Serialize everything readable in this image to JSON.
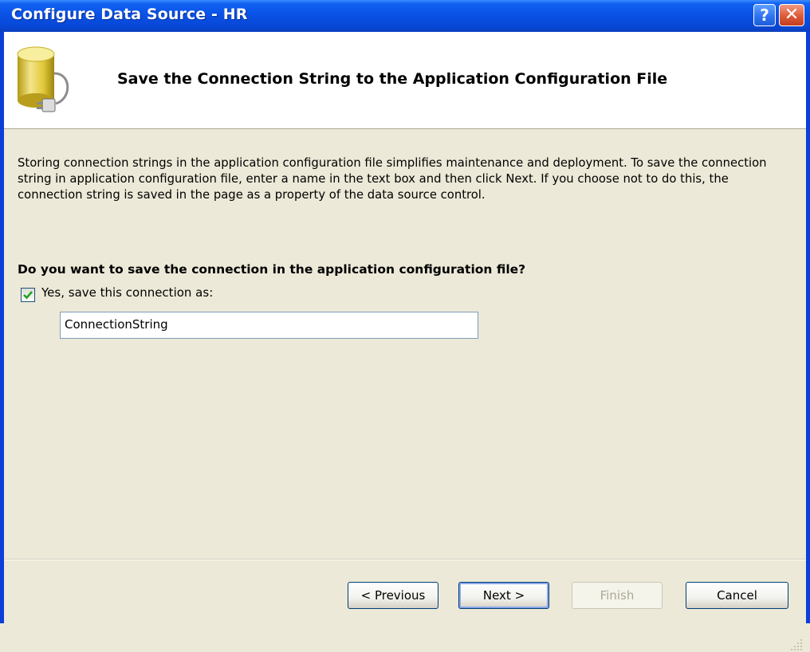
{
  "window": {
    "title": "Configure Data Source - HR",
    "help_glyph": "?",
    "close_glyph": "✕"
  },
  "header": {
    "title": "Save the Connection String to the Application Configuration File",
    "icon": "database-plug-icon"
  },
  "description": "Storing connection strings in the application configuration file simplifies maintenance and deployment. To save the connection string in application configuration file, enter a name in the text box and then click Next. If you choose not to do this, the connection string is saved in the page as a property of the data source control.",
  "question": "Do you want to save the connection in the application configuration file?",
  "save_option": {
    "checked": true,
    "label": "Yes, save this connection as:",
    "value": "ConnectionString"
  },
  "buttons": {
    "previous": "< Previous",
    "next": "Next >",
    "finish": "Finish",
    "cancel": "Cancel"
  },
  "colors": {
    "titlebar": "#0a52e6",
    "dialog_bg": "#ece9d8",
    "header_bg": "#ffffff"
  }
}
